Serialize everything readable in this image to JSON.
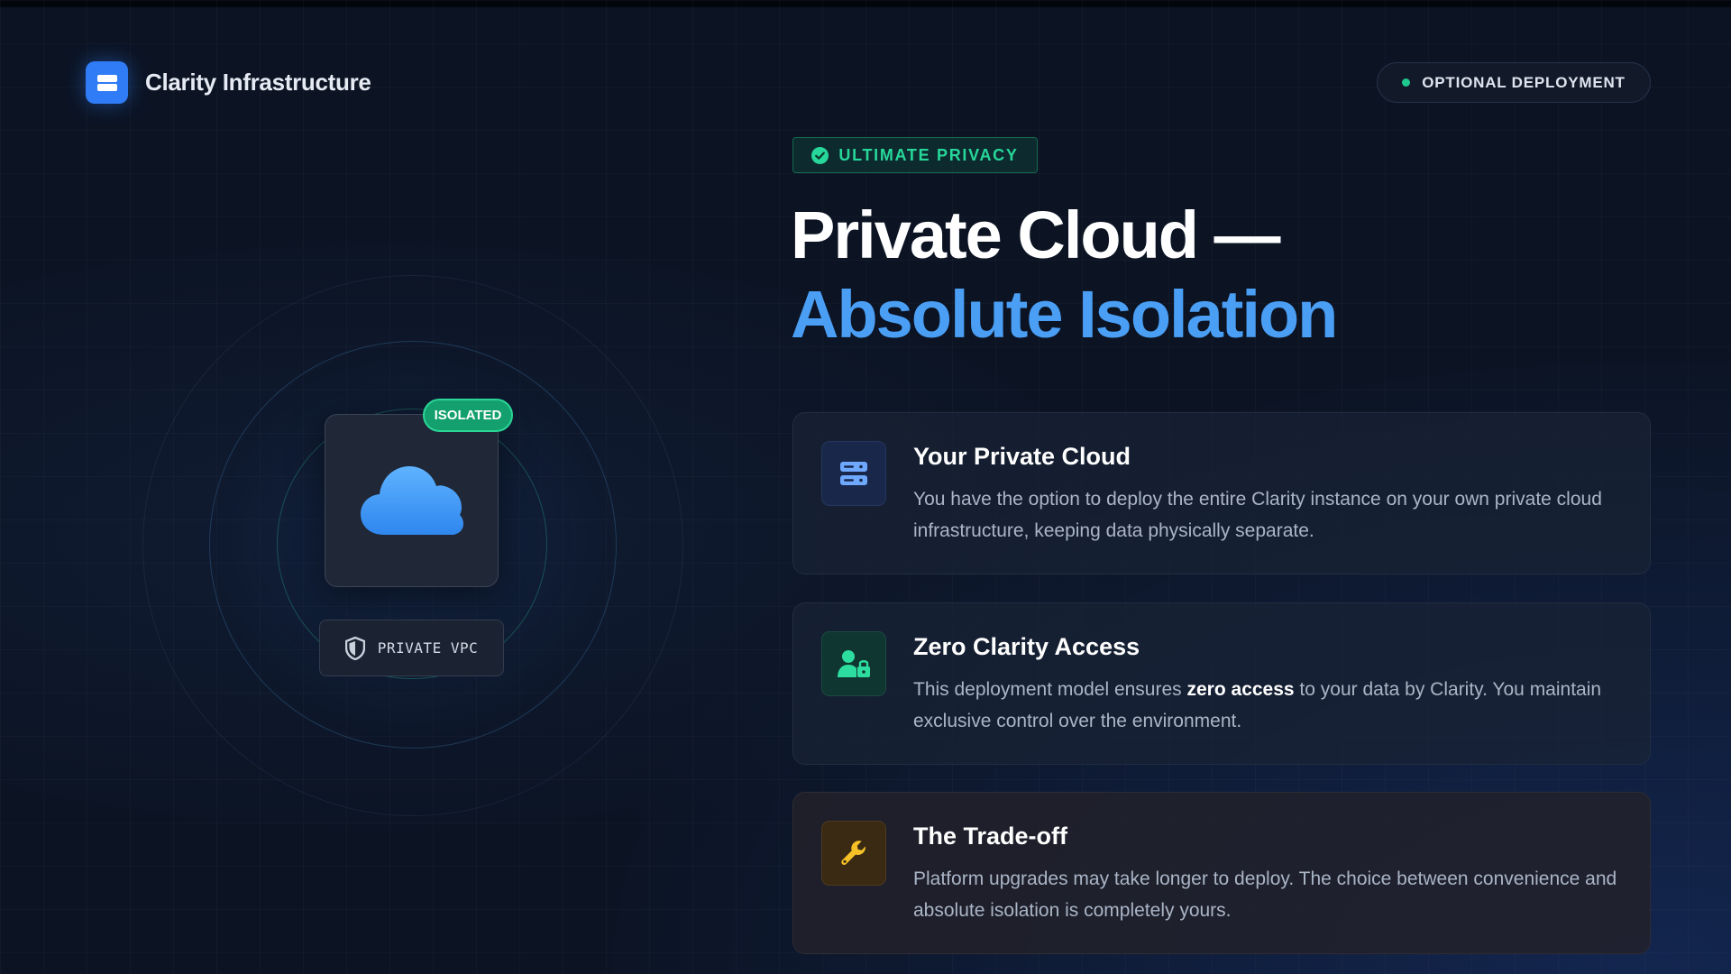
{
  "brand": {
    "name": "Clarity Infrastructure",
    "logo_icon": "server-stack-icon",
    "accent": "#2f7cf6"
  },
  "deployment_badge": {
    "label": "OPTIONAL DEPLOYMENT",
    "dot_color": "#1fc98e"
  },
  "privacy_tag": {
    "label": "ULTIMATE PRIVACY",
    "icon": "check-circle-icon",
    "color": "#27d79a"
  },
  "headline": {
    "line1": "Private Cloud —",
    "line2": "Absolute Isolation",
    "line2_color": "#4a9ff5"
  },
  "illustration": {
    "status_badge": "ISOLATED",
    "cloud_icon": "cloud-icon",
    "vpc_label": "PRIVATE VPC",
    "vpc_icon": "shield-icon"
  },
  "features": [
    {
      "title": "Your Private Cloud",
      "icon": "server-icon",
      "body": "You have the option to deploy the entire Clarity instance on your own private cloud infrastructure, keeping data physically separate."
    },
    {
      "title": "Zero Clarity Access",
      "icon": "user-lock-icon",
      "body_before": "This deployment model ensures ",
      "body_bold": "zero access",
      "body_after": " to your data by Clarity. You maintain exclusive control over the environment."
    },
    {
      "title": "The Trade-off",
      "icon": "wrench-icon",
      "body": "Platform upgrades may take longer to deploy. The choice between convenience and absolute isolation is completely yours."
    }
  ]
}
